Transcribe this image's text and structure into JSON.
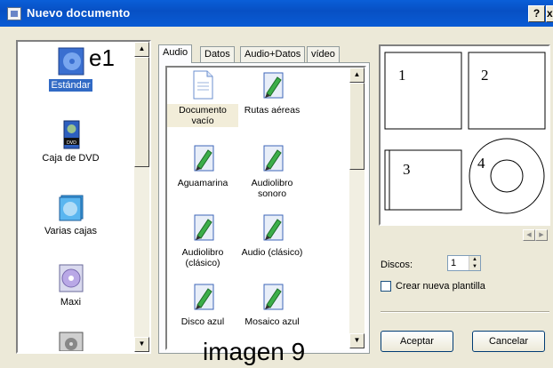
{
  "window": {
    "title": "Nuevo documento",
    "help_label": "?",
    "close_label": "x"
  },
  "overlay": {
    "e1": "e1",
    "imagen": "imagen 9"
  },
  "left_list": {
    "items": [
      {
        "label": "Estándar",
        "icon": "cd-case-icon",
        "selected": true
      },
      {
        "label": "Caja de DVD",
        "icon": "dvd-case-icon",
        "selected": false
      },
      {
        "label": "Varias cajas",
        "icon": "multi-case-icon",
        "selected": false
      },
      {
        "label": "Maxi",
        "icon": "maxi-disc-icon",
        "selected": false
      },
      {
        "label": "",
        "icon": "disc-icon",
        "selected": false
      }
    ]
  },
  "tabs": [
    {
      "label": "Audio",
      "active": true
    },
    {
      "label": "Datos",
      "active": false
    },
    {
      "label": "Audio+Datos",
      "active": false
    },
    {
      "label": "vídeo",
      "active": false
    }
  ],
  "templates": [
    {
      "label": "Documento vacío",
      "icon": "blank-document-icon",
      "selected": true
    },
    {
      "label": "Rutas aéreas",
      "icon": "template-icon"
    },
    {
      "label": "Aguamarina",
      "icon": "template-icon"
    },
    {
      "label": "Audiolibro sonoro",
      "icon": "template-icon"
    },
    {
      "label": "Audiolibro (clásico)",
      "icon": "template-icon"
    },
    {
      "label": "Audio (clásico)",
      "icon": "template-icon"
    },
    {
      "label": "Disco azul",
      "icon": "template-icon"
    },
    {
      "label": "Mosaico azul",
      "icon": "template-icon"
    }
  ],
  "preview": {
    "labels": [
      "1",
      "2",
      "3",
      "4"
    ]
  },
  "options": {
    "discos_label": "Discos:",
    "discos_value": "1",
    "new_template_label": "Crear nueva plantilla"
  },
  "buttons": {
    "accept": "Aceptar",
    "cancel": "Cancelar"
  },
  "colors": {
    "title_bar": "#0a5bd4",
    "selection": "#316ac5",
    "dialog_bg": "#ece9d8"
  }
}
